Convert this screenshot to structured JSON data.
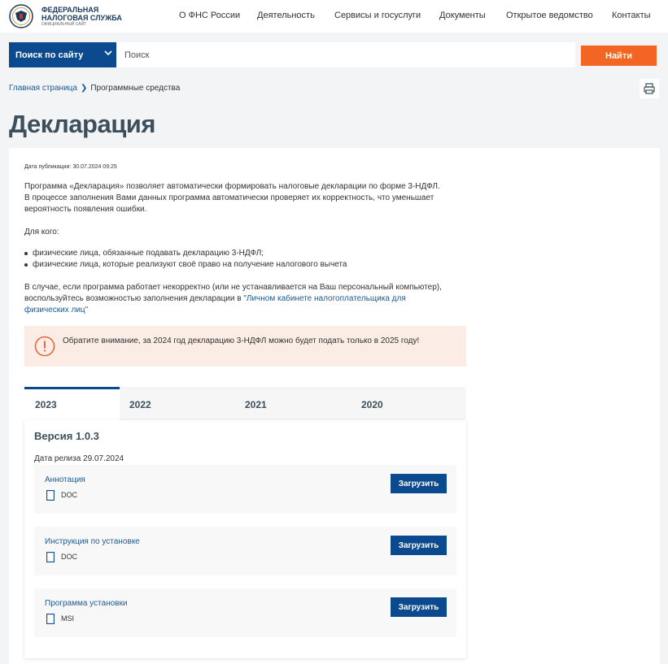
{
  "header": {
    "logo_line1": "ФЕДЕРАЛЬНАЯ",
    "logo_line2": "НАЛОГОВАЯ СЛУЖБА",
    "logo_line3": "ОФИЦИАЛЬНЫЙ САЙТ",
    "nav": [
      "О ФНС России",
      "Деятельность",
      "Сервисы и госуслуги",
      "Документы",
      "Открытое ведомство",
      "Контакты"
    ]
  },
  "search": {
    "scope_label": "Поиск по сайту",
    "placeholder": "Поиск",
    "button_label": "Найти"
  },
  "breadcrumb": {
    "home": "Главная страница",
    "current": "Программные средства"
  },
  "page": {
    "title": "Декларация",
    "pub_date": "Дата публикации: 30.07.2024 09:25",
    "intro_line1": "Программа «Декларация» позволяет автоматически формировать налоговые декларации по форме 3-НДФЛ.",
    "intro_line2": "В процессе заполнения Вами данных программа автоматически проверяет их корректность, что уменьшает",
    "intro_line3": "вероятность появления ошибки.",
    "for_whom": "Для кого:",
    "bullets": [
      "физические лица, обязанные подавать декларацию 3-НДФЛ;",
      "физические лица, которые реализуют своё право на получение налогового вычета"
    ],
    "note_line1": "В случае, если программа работает некорректно (или не устанавливается на Ваш персональный компьютер),",
    "note_line2": "воспользуйтесь возможностью заполнения декларации в ",
    "note_link_part1": "\"Личном кабинете налогоплательщика для",
    "note_link_part2": "физических лиц\"",
    "notice": "Обратите внимание, за 2024 год декларацию 3-НДФЛ можно будет подать только в 2025 году!"
  },
  "tabs": [
    "2023",
    "2022",
    "2021",
    "2020"
  ],
  "active_tab": "2023",
  "panel": {
    "version": "Версия 1.0.3",
    "release_date": "Дата релиза 29.07.2024",
    "files": [
      {
        "name": "Аннотация",
        "type": "DOC",
        "button": "Загрузить"
      },
      {
        "name": "Инструкция по установке",
        "type": "DOC",
        "button": "Загрузить"
      },
      {
        "name": "Программа установки",
        "type": "MSI",
        "button": "Загрузить"
      }
    ]
  },
  "colors": {
    "brand_blue": "#0b4a8f",
    "accent_orange": "#f26522",
    "notice_bg": "#fbece6",
    "title_gray": "#3d4f5c"
  },
  "icons": {
    "logo": "fns-emblem-icon",
    "print": "printer-icon",
    "notice": "info-circle-icon",
    "file": "document-icon",
    "chevron": "chevron-down-icon"
  }
}
